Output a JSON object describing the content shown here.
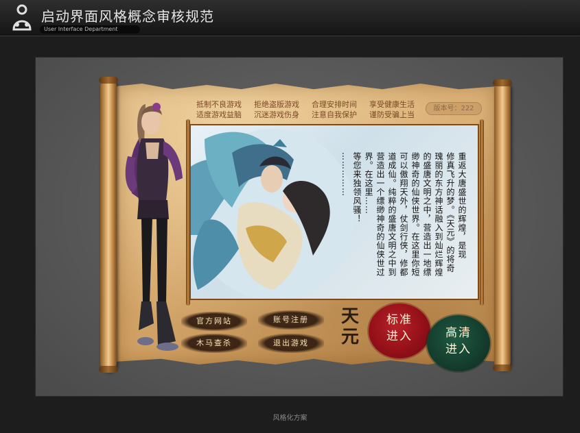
{
  "header": {
    "title": "启动界面风格概念审核规范",
    "subtitle": "User Interface Department"
  },
  "launcher": {
    "slogans": [
      [
        "抵制不良游戏",
        "适度游戏益脑"
      ],
      [
        "拒绝盗版游戏",
        "沉迷游戏伤身"
      ],
      [
        "合理安排时间",
        "注意自我保护"
      ],
      [
        "享受健康生活",
        "谨防受骗上当"
      ]
    ],
    "version_label": "版本号：222",
    "story_lines": [
      "重返大唐盛世的辉煌，是现",
      "修真飞升的梦。《天元》的将奇",
      "瑰丽的东方神话融入到灿烂辉煌",
      "的盛唐文明之中，营造出一地缥",
      "缈神奇的仙侠世界。在这里你短",
      "可以傲翔天外，仗剑行侠，修都",
      "道成仙。纯粹的盛唐文明之中到",
      "营造出一个缥缈神奇的仙侠世过",
      "界。在这里……",
      "等您来独领风骚！",
      "……………"
    ],
    "buttons": {
      "official_site": "官方网站",
      "account_register": "账号注册",
      "trojan_scan": "木马查杀",
      "exit_game": "退出游戏"
    },
    "logo_chars": [
      "天",
      "元"
    ],
    "start_standard": [
      "标准",
      "进入"
    ],
    "start_hd": [
      "高清",
      "进入"
    ]
  },
  "footer": {
    "caption": "风格化方案"
  }
}
